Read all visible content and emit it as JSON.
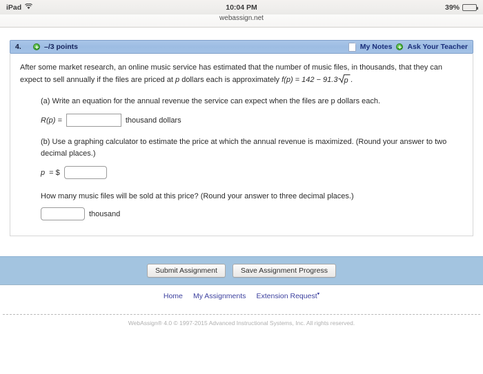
{
  "status_bar": {
    "device": "iPad",
    "wifi_icon": "wifi-icon",
    "time": "10:04 PM",
    "battery_percent": "39%",
    "battery_level": 39
  },
  "browser": {
    "url": "webassign.net"
  },
  "question": {
    "number": "4.",
    "points": "–/3 points",
    "points_icon": "plus-circle-icon",
    "my_notes_label": "My Notes",
    "my_notes_icon": "notes-page-icon",
    "ask_teacher_label": "Ask Your Teacher",
    "ask_teacher_icon": "plus-circle-icon",
    "prompt_line1": "After some market research, an online music service has estimated that the number of music files, in thousands, that they can",
    "prompt_line2_pre": "expect to sell annually if the files are priced at ",
    "prompt_var": "p",
    "prompt_line2_post": " dollars each is approximately ",
    "formula": {
      "function_name": "f",
      "variable": "p",
      "expression": "f(p) = 142 − 91.3√p",
      "coefficient_constant": "142",
      "coefficient_sqrt": "91.3",
      "lead": "f(p) = 142 − 91.3",
      "radicand": "p",
      "trailing": "."
    },
    "part_a": {
      "label": "(a)",
      "text": "Write an equation for the annual revenue the service can expect when the files are p dollars each.",
      "answer_prefix": "R(p) =",
      "answer_value": "",
      "answer_unit": "thousand dollars"
    },
    "part_b": {
      "label": "(b)",
      "text": "Use a graphing calculator to estimate the price at which the annual revenue is maximized. (Round your answer to two decimal places.)",
      "answer_prefix_var": "p",
      "answer_prefix_rest": "= $",
      "answer_value": ""
    },
    "part_c": {
      "text": "How many music files will be sold at this price? (Round your answer to three decimal places.)",
      "answer_value": "",
      "answer_unit": "thousand"
    }
  },
  "actions": {
    "submit_label": "Submit Assignment",
    "save_label": "Save Assignment Progress"
  },
  "footer": {
    "links": [
      {
        "label": "Home",
        "mark": ""
      },
      {
        "label": "My Assignments",
        "mark": ""
      },
      {
        "label": "Extension Request",
        "mark": "▾"
      }
    ],
    "copyright": "WebAssign® 4.0 © 1997-2015 Advanced Instructional Systems, Inc. All rights reserved."
  },
  "colors": {
    "header_blue": "#a4c2e6",
    "action_bar_blue": "#a3c4e0",
    "link_blue": "#3b3f9e",
    "accent_green": "#3ba52c"
  }
}
